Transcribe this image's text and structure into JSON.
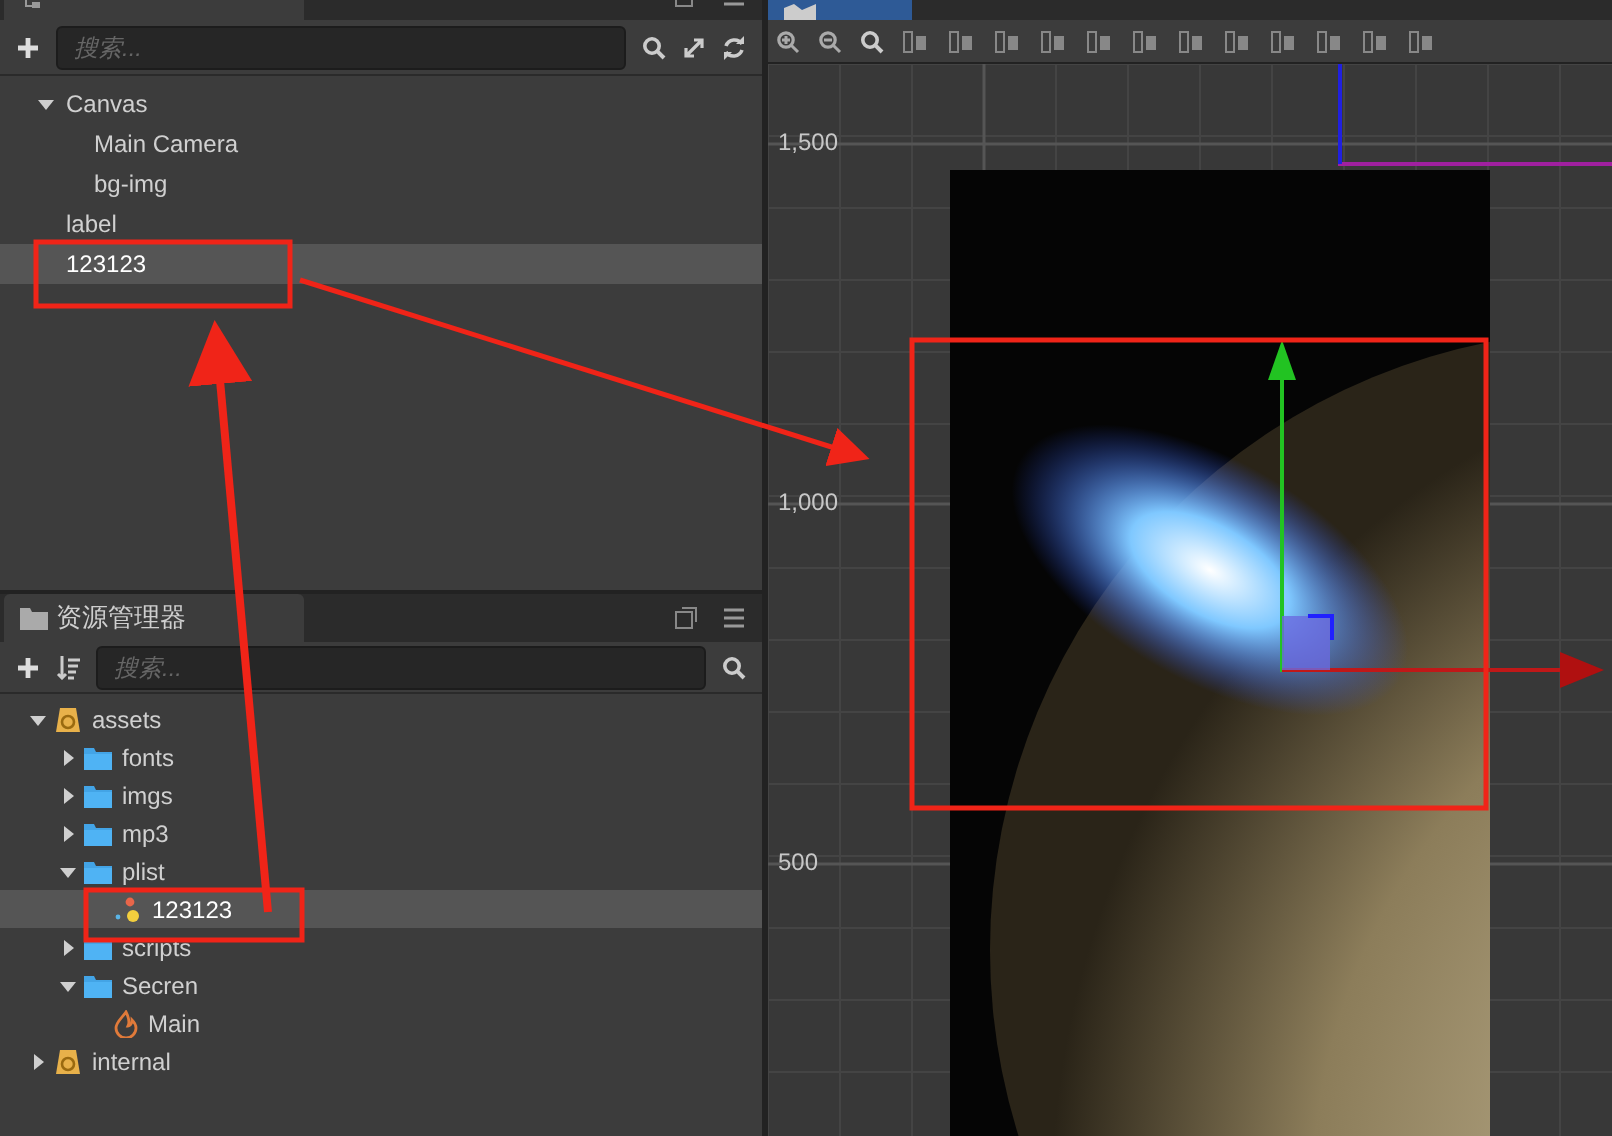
{
  "hierarchy_panel": {
    "search": {
      "placeholder": "搜索..."
    },
    "tree": [
      {
        "label": "Canvas",
        "expanded": true,
        "selected": false,
        "children": [
          {
            "label": "Main Camera",
            "selected": false
          },
          {
            "label": "bg-img",
            "selected": false
          }
        ]
      },
      {
        "label": "label",
        "selected": false
      },
      {
        "label": "123123",
        "selected": true
      }
    ]
  },
  "assets_panel": {
    "title": "资源管理器",
    "search": {
      "placeholder": "搜索..."
    },
    "tree": [
      {
        "label": "assets",
        "kind": "db",
        "expanded": true,
        "selected": false,
        "children": [
          {
            "label": "fonts",
            "kind": "folder",
            "expanded": false,
            "selected": false
          },
          {
            "label": "imgs",
            "kind": "folder",
            "expanded": false,
            "selected": false
          },
          {
            "label": "mp3",
            "kind": "folder",
            "expanded": false,
            "selected": false
          },
          {
            "label": "plist",
            "kind": "folder",
            "expanded": true,
            "selected": false,
            "children": [
              {
                "label": "123123",
                "kind": "particle",
                "selected": true
              }
            ]
          },
          {
            "label": "scripts",
            "kind": "folder",
            "expanded": false,
            "selected": false
          },
          {
            "label": "Secren",
            "kind": "folder",
            "expanded": true,
            "selected": false,
            "children": [
              {
                "label": "Main",
                "kind": "scene",
                "selected": false
              }
            ]
          }
        ]
      },
      {
        "label": "internal",
        "kind": "db",
        "expanded": false,
        "selected": false
      }
    ]
  },
  "scene_panel": {
    "ruler_labels": [
      "1,500",
      "1,000",
      "500"
    ]
  }
}
